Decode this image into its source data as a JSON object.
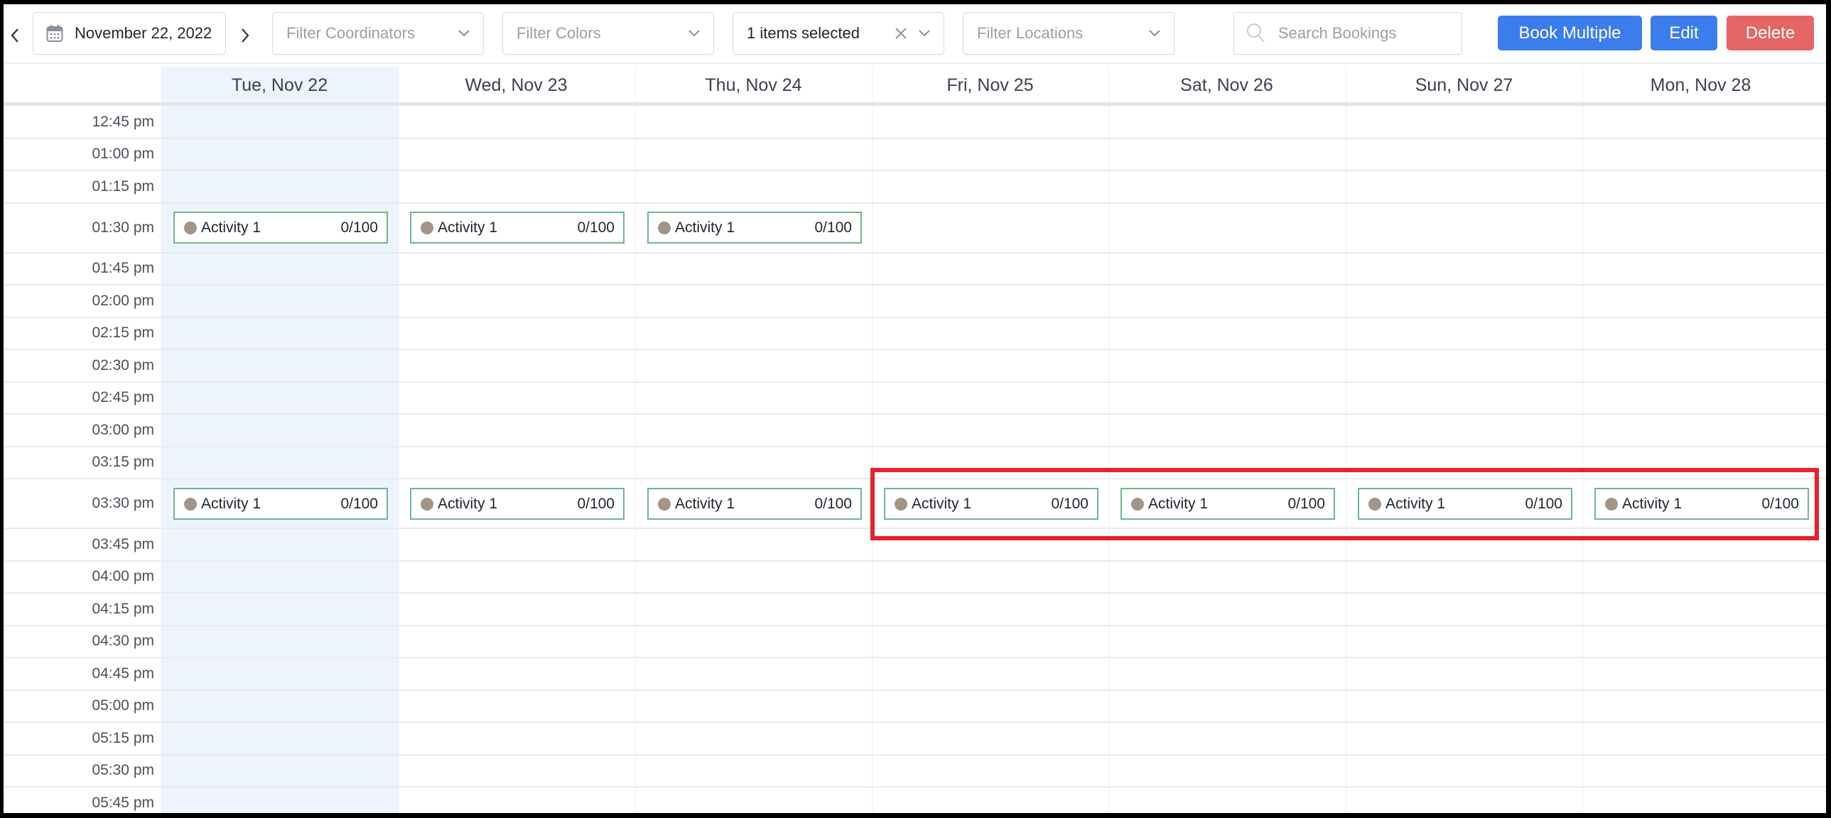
{
  "toolbar": {
    "prev_label": "previous",
    "next_label": "next",
    "date_value": "November 22, 2022",
    "filters": [
      {
        "placeholder": "Filter Coordinators",
        "value": ""
      },
      {
        "placeholder": "Filter Colors",
        "value": ""
      },
      {
        "placeholder": "",
        "value": "1 items selected"
      },
      {
        "placeholder": "Filter Locations",
        "value": ""
      }
    ],
    "search_placeholder": "Search Bookings",
    "buttons": {
      "book_multiple": "Book Multiple",
      "edit": "Edit",
      "delete": "Delete"
    }
  },
  "colors": {
    "primary": "#3b7ded",
    "danger": "#e56565",
    "today_highlight": "#edf4fe",
    "card_border": "#6cb88a",
    "card_dot": "#a39488",
    "selection_box": "#e8202a"
  },
  "calendar": {
    "days": [
      "Tue, Nov 22",
      "Wed, Nov 23",
      "Thu, Nov 24",
      "Fri, Nov 25",
      "Sat, Nov 26",
      "Sun, Nov 27",
      "Mon, Nov 28"
    ],
    "highlighted_day": "Tue, Nov 22",
    "times": [
      "12:45 pm",
      "01:00 pm",
      "01:15 pm",
      "01:30 pm",
      "01:45 pm",
      "02:00 pm",
      "02:15 pm",
      "02:30 pm",
      "02:45 pm",
      "03:00 pm",
      "03:15 pm",
      "03:30 pm",
      "03:45 pm",
      "04:00 pm",
      "04:15 pm",
      "04:30 pm",
      "04:45 pm",
      "05:00 pm",
      "05:15 pm",
      "05:30 pm",
      "05:45 pm"
    ],
    "events": [
      {
        "day": 0,
        "time": "01:30 pm",
        "name": "Activity 1",
        "count": "0/100"
      },
      {
        "day": 1,
        "time": "01:30 pm",
        "name": "Activity 1",
        "count": "0/100"
      },
      {
        "day": 2,
        "time": "01:30 pm",
        "name": "Activity 1",
        "count": "0/100"
      },
      {
        "day": 0,
        "time": "03:30 pm",
        "name": "Activity 1",
        "count": "0/100"
      },
      {
        "day": 1,
        "time": "03:30 pm",
        "name": "Activity 1",
        "count": "0/100"
      },
      {
        "day": 2,
        "time": "03:30 pm",
        "name": "Activity 1",
        "count": "0/100"
      },
      {
        "day": 3,
        "time": "03:30 pm",
        "name": "Activity 1",
        "count": "0/100"
      },
      {
        "day": 4,
        "time": "03:30 pm",
        "name": "Activity 1",
        "count": "0/100"
      },
      {
        "day": 5,
        "time": "03:30 pm",
        "name": "Activity 1",
        "count": "0/100"
      },
      {
        "day": 6,
        "time": "03:30 pm",
        "name": "Activity 1",
        "count": "0/100"
      }
    ],
    "selection": {
      "time": "03:30 pm",
      "days": [
        3,
        4,
        5,
        6
      ]
    }
  }
}
